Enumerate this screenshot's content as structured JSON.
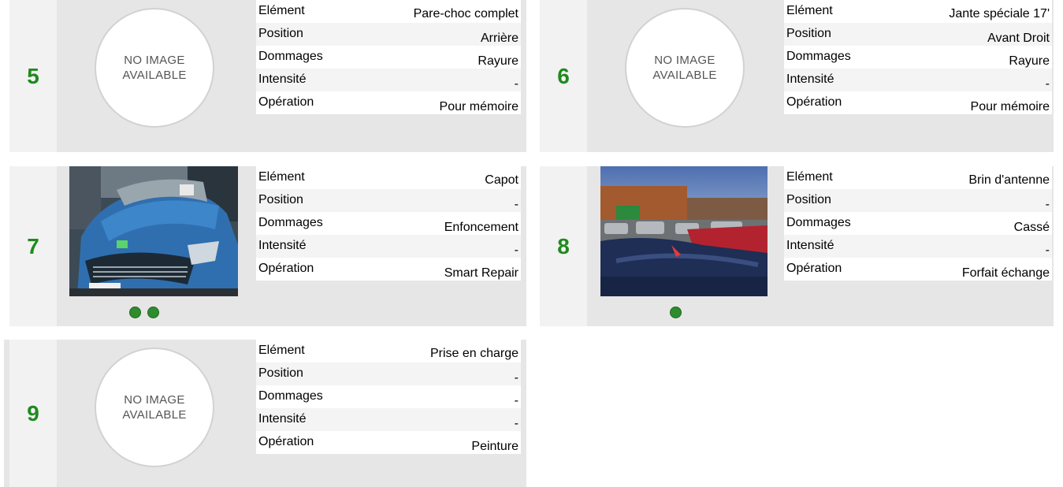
{
  "no_image_text": [
    "NO IMAGE",
    "AVAILABLE"
  ],
  "labels": [
    "Elément",
    "Position",
    "Dommages",
    "Intensité",
    "Opération"
  ],
  "colors": {
    "accent_green": "#1f8a1f",
    "card_bg": "#e6e6e6",
    "number_col_bg": "#f2f2f2"
  },
  "cards": [
    {
      "number": "5",
      "image": "no-image",
      "photo_dots": 0,
      "values": [
        "Pare-choc complet",
        "Arrière",
        "Rayure",
        "-",
        "Pour mémoire"
      ]
    },
    {
      "number": "6",
      "image": "no-image",
      "photo_dots": 0,
      "values": [
        "Jante spéciale 17'",
        "Avant Droit",
        "Rayure",
        "-",
        "Pour mémoire"
      ]
    },
    {
      "number": "7",
      "image": "photo-car-front",
      "photo_dots": 2,
      "values": [
        "Capot",
        "-",
        "Enfoncement",
        "-",
        "Smart Repair"
      ]
    },
    {
      "number": "8",
      "image": "photo-car-roof",
      "photo_dots": 1,
      "values": [
        "Brin d'antenne",
        "-",
        "Cassé",
        "-",
        "Forfait échange"
      ]
    },
    {
      "number": "9",
      "image": "no-image",
      "photo_dots": 0,
      "values": [
        "Prise en charge",
        "-",
        "-",
        "-",
        "Peinture"
      ]
    }
  ]
}
